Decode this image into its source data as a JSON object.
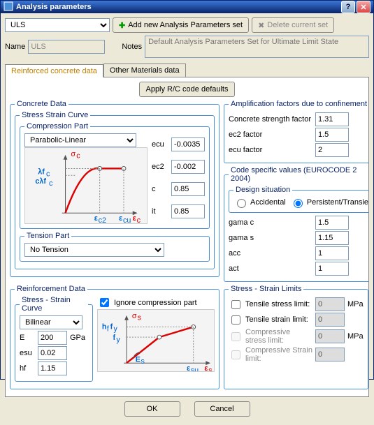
{
  "window": {
    "title": "Analysis parameters"
  },
  "topbar": {
    "set_select": "ULS",
    "add_btn": "Add new Analysis Parameters set",
    "delete_btn": "Delete current set"
  },
  "form": {
    "name_label": "Name",
    "name_value": "ULS",
    "notes_label": "Notes",
    "notes_placeholder": "Default Analysis Parameters Set for Ultimate Limit State"
  },
  "tabs": {
    "rc": "Reinforced concrete data",
    "other": "Other Materials data"
  },
  "apply_btn": "Apply R/C code defaults",
  "concrete": {
    "legend": "Concrete Data",
    "ssc_legend": "Stress Strain Curve",
    "comp_legend": "Compression Part",
    "comp_select": "Parabolic-Linear",
    "tension_legend": "Tension Part",
    "tension_select": "No Tension",
    "params": {
      "ecu_l": "ecu",
      "ecu_v": "-0.0035",
      "ec2_l": "ec2",
      "ec2_v": "-0.002",
      "c_l": "c",
      "c_v": "0.85",
      "it_l": "it",
      "it_v": "0.85"
    },
    "sigma": "σ",
    "sigma_sub": "c",
    "lambda_fc": "λf",
    "clambda_fc": "cλf",
    "eps_c2": "ε",
    "eps_cu": "ε",
    "eps_c": "ε"
  },
  "amp": {
    "legend": "Amplification factors due to confinement",
    "csf_l": "Concrete strength factor",
    "csf_v": "1.31",
    "ec2_l": "ec2 factor",
    "ec2_v": "1.5",
    "ecu_l": "ecu factor",
    "ecu_v": "2"
  },
  "code": {
    "legend": "Code specific values (EUROCODE 2 2004)",
    "design_legend": "Design situation",
    "accidental": "Accidental",
    "persistent": "Persistent/Transient",
    "gc_l": "gama c",
    "gc_v": "1.5",
    "gs_l": "gama s",
    "gs_v": "1.15",
    "acc_l": "acc",
    "acc_v": "1",
    "act_l": "act",
    "act_v": "1"
  },
  "reinf": {
    "legend": "Reinforcement Data",
    "ssc_legend": "Stress - Strain Curve",
    "model": "Bilinear",
    "ignore": "Ignore compression part",
    "E_l": "E",
    "E_v": "200",
    "E_u": "GPa",
    "esu_l": "esu",
    "esu_v": "0.02",
    "hf_l": "hf",
    "hf_v": "1.15",
    "sigma_s": "σ",
    "hf_fy": "h f",
    "fy": "f",
    "Es": "E",
    "eps_su": "ε",
    "eps_s": "ε"
  },
  "limits": {
    "legend": "Stress - Strain Limits",
    "ts_l": "Tensile stress limit:",
    "ts_v": "0",
    "mpa": "MPa",
    "te_l": "Tensile strain limit:",
    "te_v": "0",
    "cs_l": "Compressive stress limit:",
    "cs_v": "0",
    "ce_l": "Compressive Strain limit:",
    "ce_v": "0"
  },
  "footer": {
    "ok": "OK",
    "cancel": "Cancel"
  }
}
